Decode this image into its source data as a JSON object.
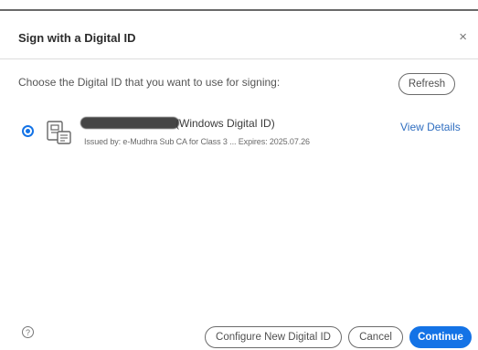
{
  "dialog": {
    "title": "Sign with a Digital ID",
    "close_glyph": "×",
    "prompt": "Choose the Digital ID that you want to use for signing:",
    "refresh_label": "Refresh"
  },
  "digital_ids": [
    {
      "selected": true,
      "name_suffix": "(Windows Digital ID)",
      "details": "Issued by: e-Mudhra Sub CA for Class 3 ... Expires: 2025.07.26",
      "view_details_label": "View Details",
      "icon": "certificate-icon"
    }
  ],
  "footer": {
    "help_icon": "help-icon",
    "help_glyph": "?",
    "configure_label": "Configure New Digital ID",
    "cancel_label": "Cancel",
    "continue_label": "Continue"
  },
  "colors": {
    "accent": "#1473e6",
    "link": "#2f6ec0",
    "border": "#6b6b6b"
  }
}
